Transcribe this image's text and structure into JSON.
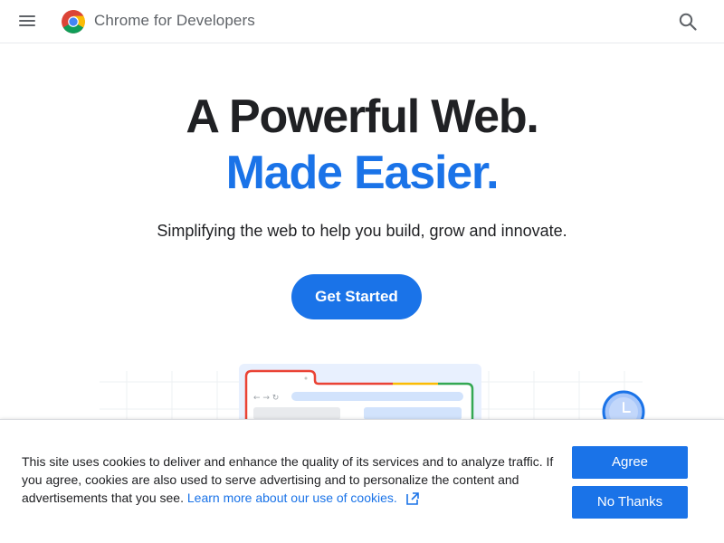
{
  "header": {
    "brand": "Chrome for Developers",
    "menu_icon": "hamburger-menu-icon",
    "logo_icon": "chrome-logo-icon",
    "search_icon": "search-icon"
  },
  "hero": {
    "title_line1": "A Powerful Web.",
    "title_line2": "Made Easier.",
    "subtitle": "Simplifying the web to help you build, grow and innovate.",
    "cta_label": "Get Started"
  },
  "cookie_banner": {
    "text": "This site uses cookies to deliver and enhance the quality of its services and to analyze traffic. If you agree, cookies are also used to serve advertising and to personalize the content and advertisements that you see. ",
    "link_text": "Learn more about our use of cookies.",
    "link_icon": "open-in-new-icon",
    "agree_label": "Agree",
    "decline_label": "No Thanks"
  },
  "colors": {
    "accent": "#1a73e8",
    "text": "#202124",
    "muted": "#5f6368"
  }
}
